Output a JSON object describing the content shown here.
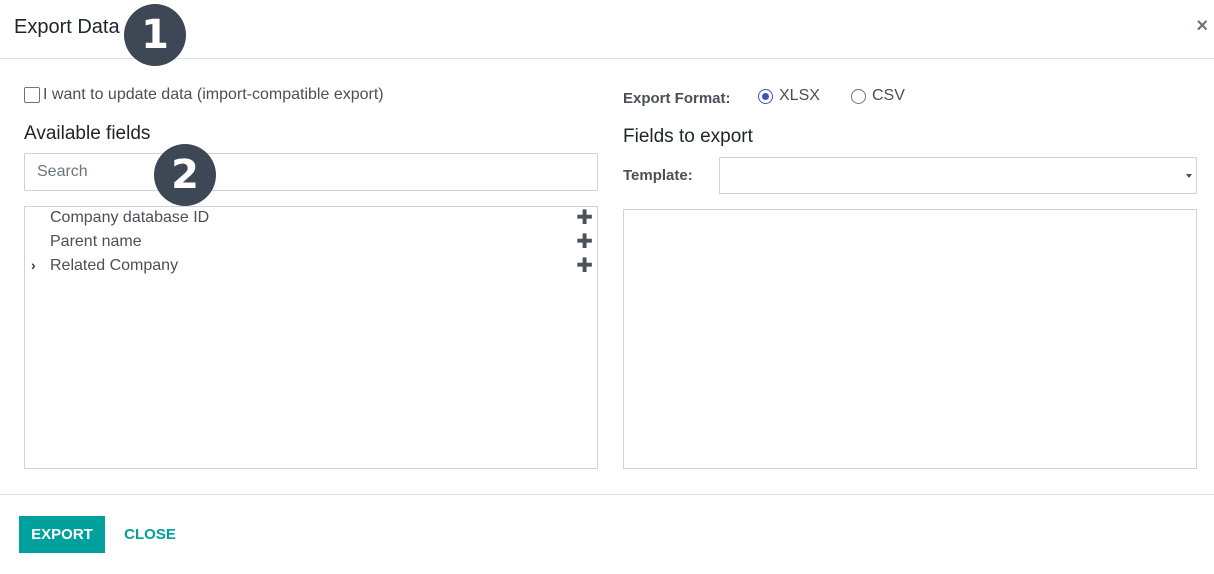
{
  "dialog": {
    "title": "Export Data",
    "close_icon": "×"
  },
  "badges": {
    "one": "1",
    "two": "2"
  },
  "options": {
    "update_data_label": "I want to update data (import-compatible export)",
    "update_data_checked": false
  },
  "available": {
    "heading": "Available fields",
    "search_placeholder": "Search",
    "fields": [
      {
        "label": "Company database ID",
        "expandable": false,
        "plus": "✚"
      },
      {
        "label": "Parent name",
        "expandable": false,
        "plus": "✚"
      },
      {
        "label": "Related Company",
        "expandable": true,
        "chevron": "›",
        "plus": "✚"
      }
    ]
  },
  "format": {
    "label": "Export Format:",
    "options": [
      {
        "label": "XLSX",
        "selected": true
      },
      {
        "label": "CSV",
        "selected": false
      }
    ]
  },
  "to_export": {
    "heading": "Fields to export",
    "template_label": "Template:",
    "template_value": ""
  },
  "footer": {
    "export_label": "EXPORT",
    "close_label": "CLOSE"
  },
  "colors": {
    "accent": "#00a09d",
    "badge": "#3e4756",
    "radio": "#3f51b5"
  }
}
